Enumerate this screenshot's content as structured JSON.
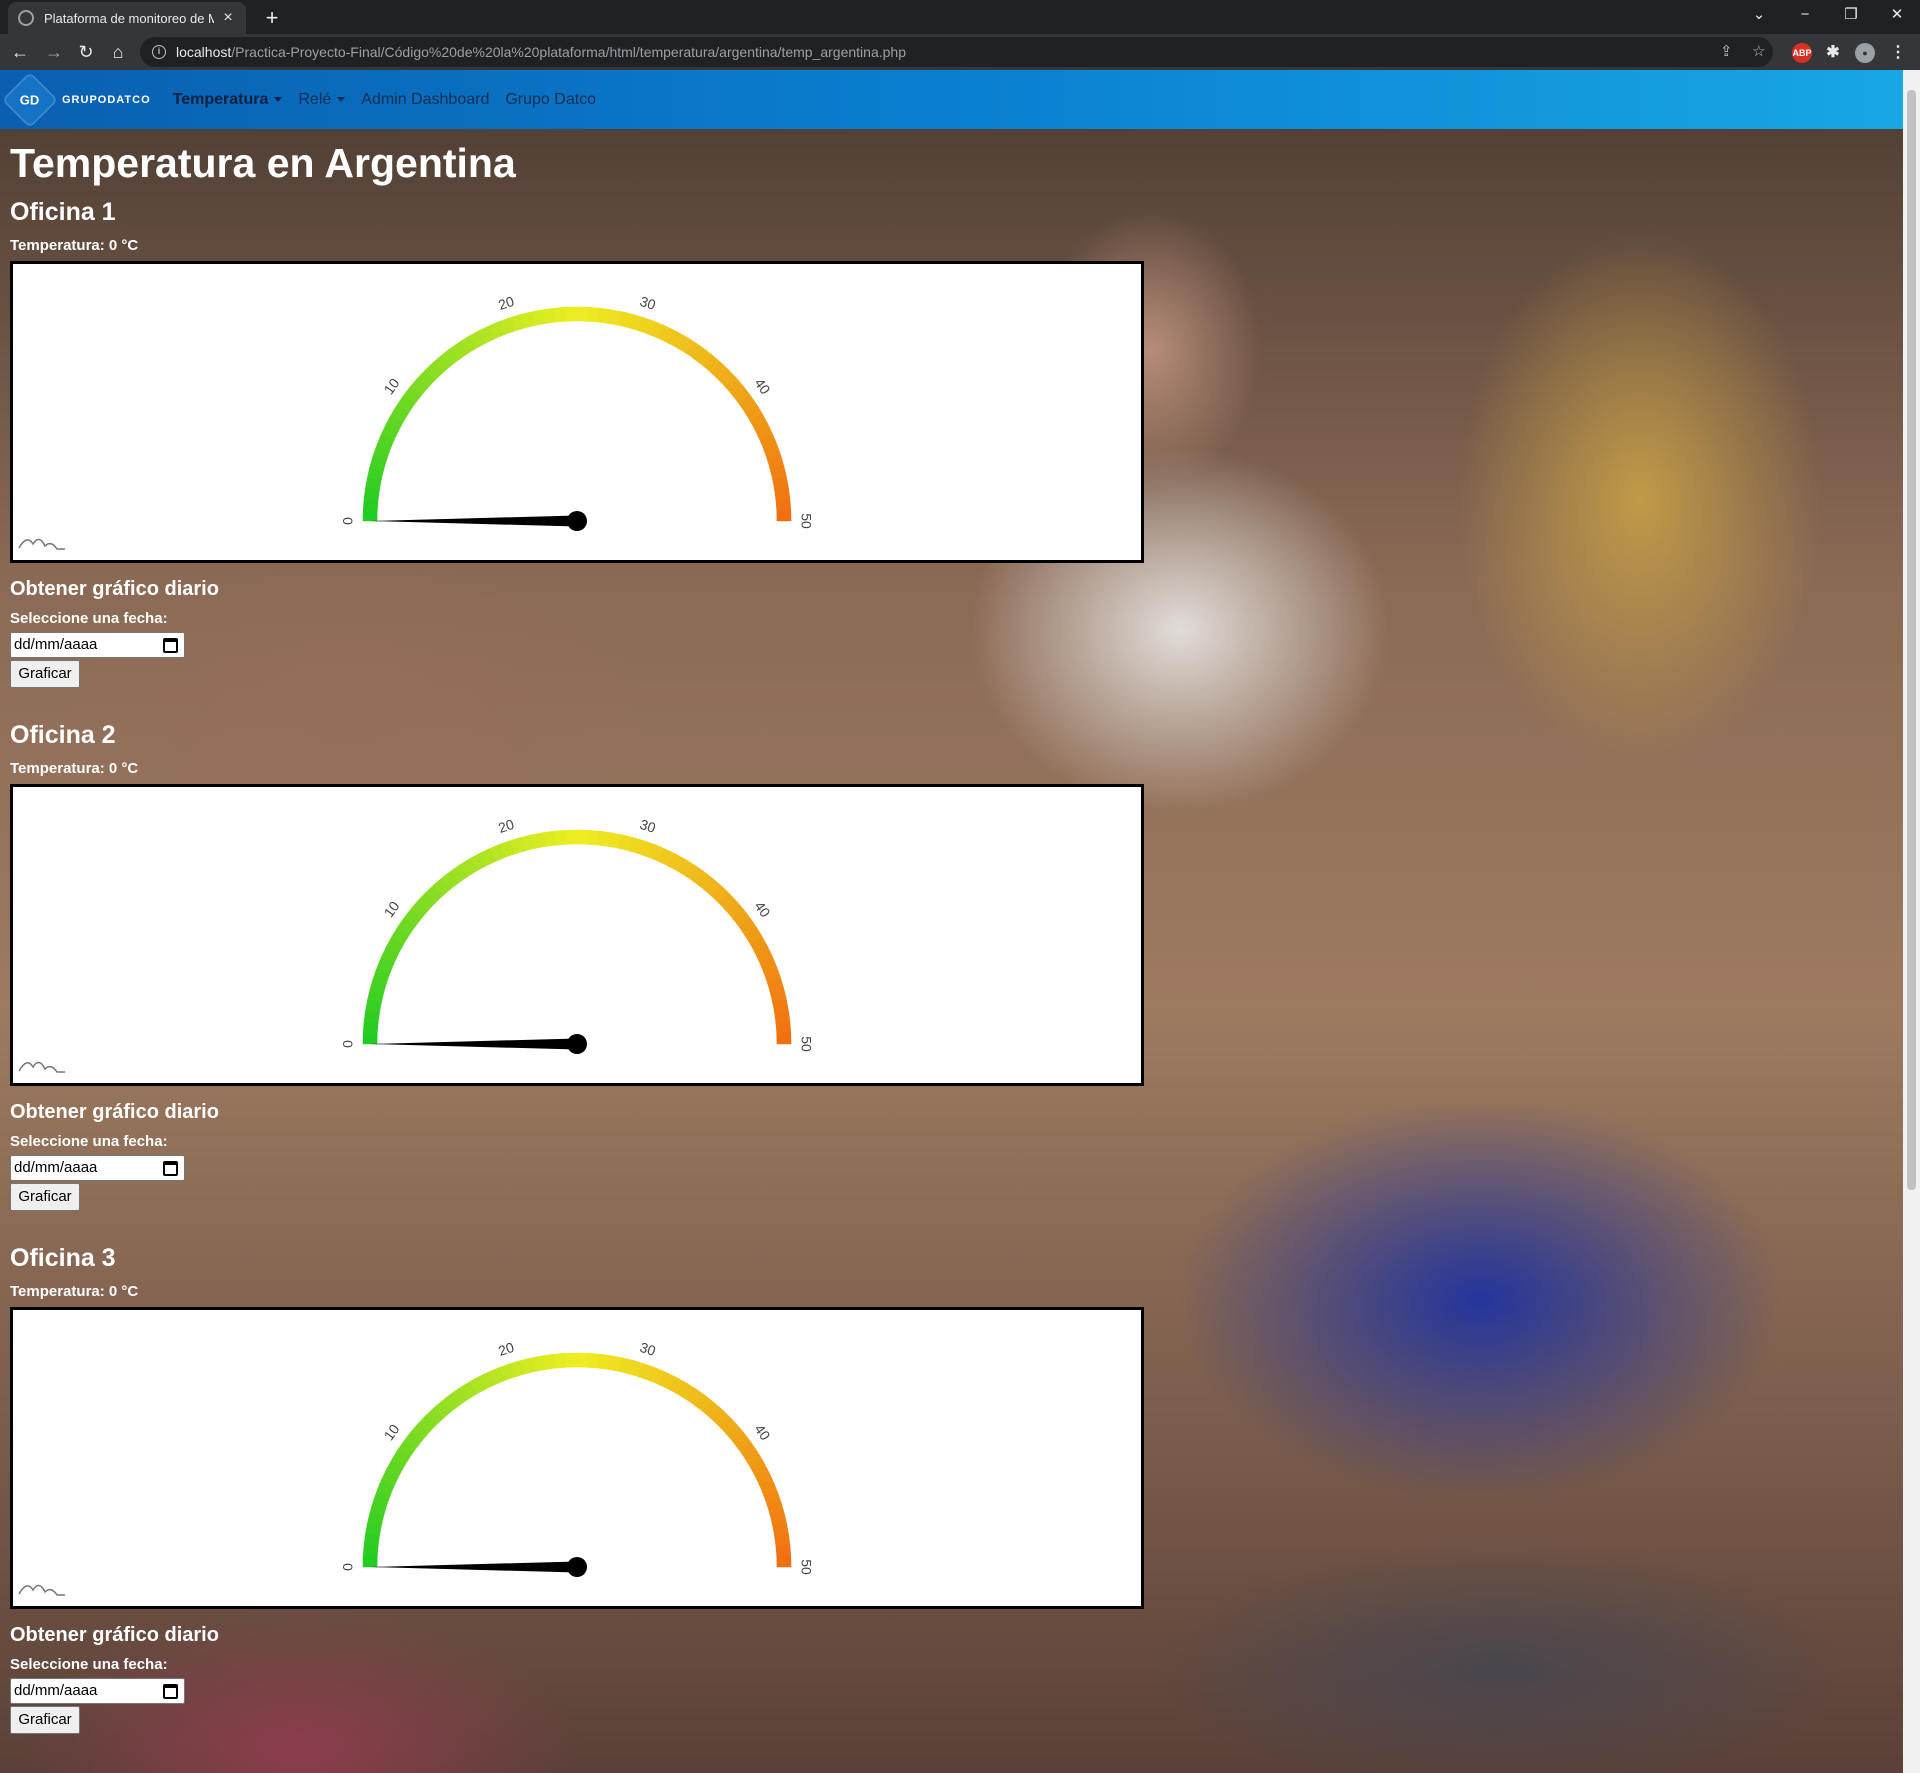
{
  "browser": {
    "tab_title": "Plataforma de monitoreo de MQ",
    "url_host": "localhost",
    "url_path": "/Practica-Proyecto-Final/Código%20de%20la%20plataforma/html/temperatura/argentina/temp_argentina.php"
  },
  "navbar": {
    "logo_text": "GRUPODATCO",
    "logo_mark": "GD",
    "items": [
      {
        "label": "Temperatura"
      },
      {
        "label": "Relé"
      },
      {
        "label": "Admin Dashboard"
      },
      {
        "label": "Grupo Datco"
      }
    ]
  },
  "page": {
    "title": "Temperatura en Argentina"
  },
  "offices": [
    {
      "name": "Oficina 1",
      "temperature_text": "Temperatura: 0 °C",
      "value": 0,
      "daily_title": "Obtener gráfico diario",
      "date_label": "Seleccione una fecha:",
      "date_placeholder": "dd/mm/aaaa",
      "button": "Graficar"
    },
    {
      "name": "Oficina 2",
      "temperature_text": "Temperatura: 0 °C",
      "value": 0,
      "daily_title": "Obtener gráfico diario",
      "date_label": "Seleccione una fecha:",
      "date_placeholder": "dd/mm/aaaa",
      "button": "Graficar"
    },
    {
      "name": "Oficina 3",
      "temperature_text": "Temperatura: 0 °C",
      "value": 0,
      "daily_title": "Obtener gráfico diario",
      "date_label": "Seleccione una fecha:",
      "date_placeholder": "dd/mm/aaaa",
      "button": "Graficar"
    }
  ],
  "chart_data": [
    {
      "type": "gauge",
      "value": 0,
      "range": [
        0,
        50
      ],
      "ticks": [
        "0",
        "10",
        "20",
        "30",
        "40",
        "50"
      ],
      "colors": [
        "#22cc22",
        "#eeee22",
        "#f07010"
      ]
    },
    {
      "type": "gauge",
      "value": 0,
      "range": [
        0,
        50
      ],
      "ticks": [
        "0",
        "10",
        "20",
        "30",
        "40",
        "50"
      ],
      "colors": [
        "#22cc22",
        "#eeee22",
        "#f07010"
      ]
    },
    {
      "type": "gauge",
      "value": 0,
      "range": [
        0,
        50
      ],
      "ticks": [
        "0",
        "10",
        "20",
        "30",
        "40",
        "50"
      ],
      "colors": [
        "#22cc22",
        "#eeee22",
        "#f07010"
      ]
    }
  ]
}
